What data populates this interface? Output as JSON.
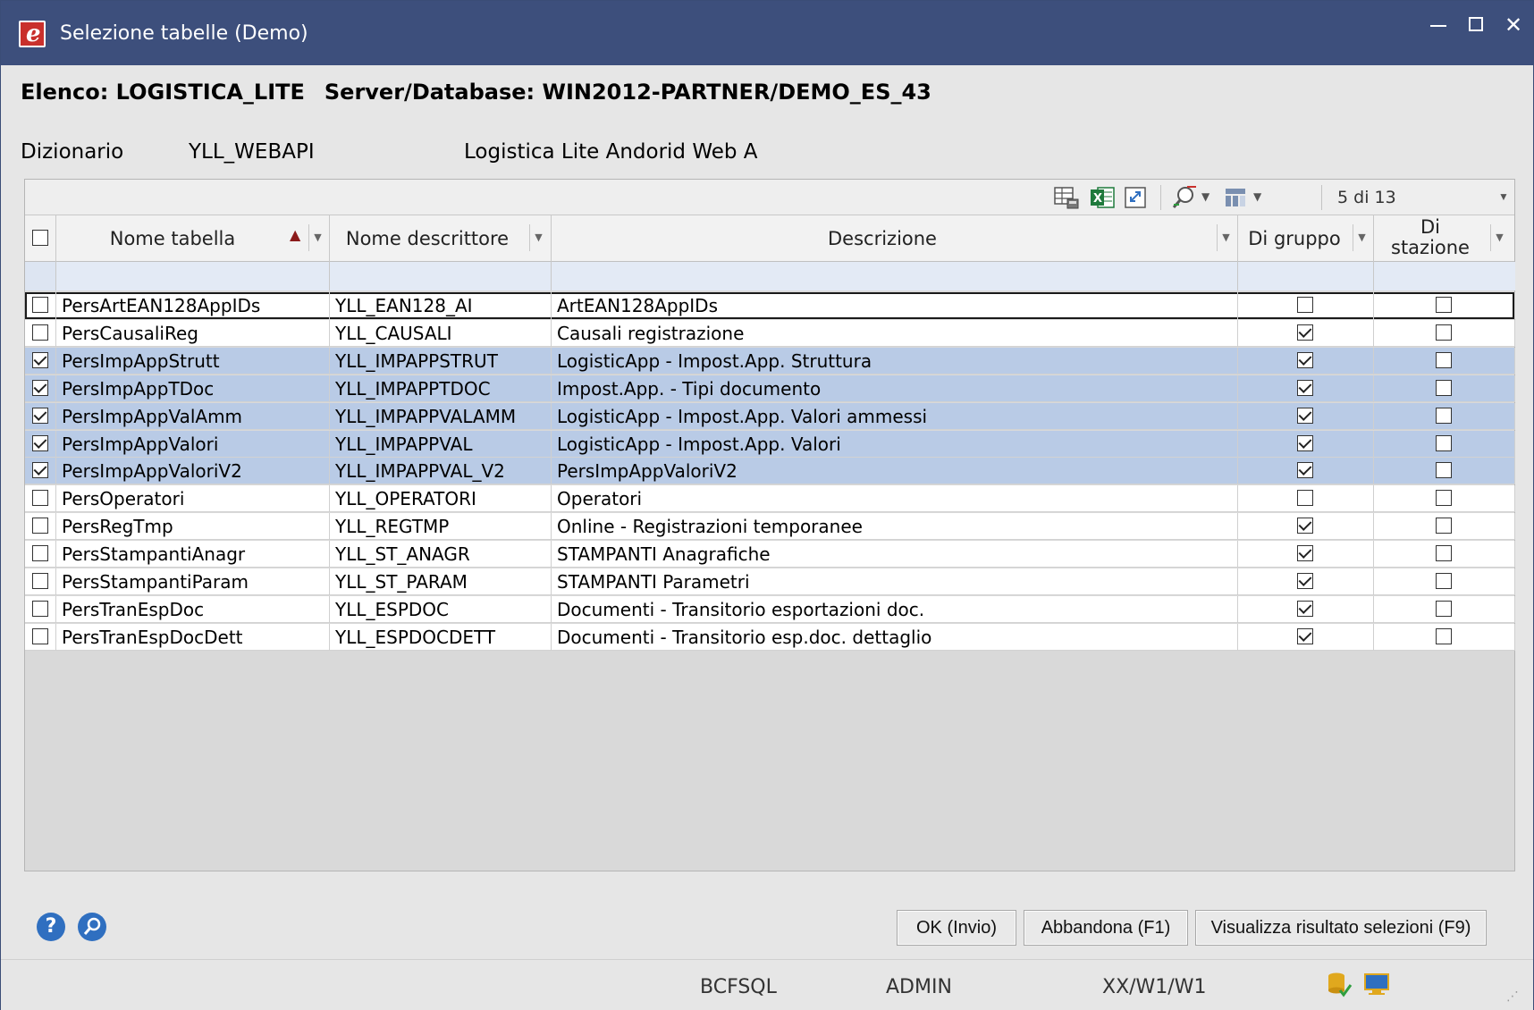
{
  "window": {
    "title": "Selezione tabelle  (Demo)",
    "app_icon_letter": "e",
    "controls": {
      "minimize": "minimize",
      "maximize": "maximize",
      "close": "✕"
    }
  },
  "header": {
    "elenco": "Elenco: LOGISTICA_LITE",
    "server": "Server/Database: WIN2012-PARTNER/DEMO_ES_43"
  },
  "dizionario": {
    "label": "Dizionario",
    "code": "YLL_WEBAPI",
    "description": "Logistica Lite Andorid Web A"
  },
  "toolbar": {
    "icons": [
      "table-export-icon",
      "excel-icon",
      "refresh-icon",
      "search-filter-icon",
      "column-chooser-icon"
    ],
    "pager": "5 di 13"
  },
  "columns": {
    "nome_tabella": "Nome tabella",
    "nome_descrittore": "Nome descrittore",
    "descrizione": "Descrizione",
    "di_gruppo": "Di gruppo",
    "di_stazione_1": "Di",
    "di_stazione_2": "stazione"
  },
  "rows": [
    {
      "selected": false,
      "nome": "PersArtEAN128AppIDs",
      "descrittore": "YLL_EAN128_AI",
      "descrizione": "ArtEAN128AppIDs",
      "gruppo": false,
      "stazione": false
    },
    {
      "selected": false,
      "nome": "PersCausaliReg",
      "descrittore": "YLL_CAUSALI",
      "descrizione": "Causali registrazione",
      "gruppo": true,
      "stazione": false
    },
    {
      "selected": true,
      "nome": "PersImpAppStrutt",
      "descrittore": "YLL_IMPAPPSTRUT",
      "descrizione": "LogisticApp - Impost.App. Struttura",
      "gruppo": true,
      "stazione": false
    },
    {
      "selected": true,
      "nome": "PersImpAppTDoc",
      "descrittore": "YLL_IMPAPPTDOC",
      "descrizione": "Impost.App. - Tipi documento",
      "gruppo": true,
      "stazione": false
    },
    {
      "selected": true,
      "nome": "PersImpAppValAmm",
      "descrittore": "YLL_IMPAPPVALAMM",
      "descrizione": "LogisticApp - Impost.App. Valori ammessi",
      "gruppo": true,
      "stazione": false
    },
    {
      "selected": true,
      "nome": "PersImpAppValori",
      "descrittore": "YLL_IMPAPPVAL",
      "descrizione": "LogisticApp - Impost.App. Valori",
      "gruppo": true,
      "stazione": false
    },
    {
      "selected": true,
      "nome": "PersImpAppValoriV2",
      "descrittore": "YLL_IMPAPPVAL_V2",
      "descrizione": "PersImpAppValoriV2",
      "gruppo": true,
      "stazione": false
    },
    {
      "selected": false,
      "nome": "PersOperatori",
      "descrittore": "YLL_OPERATORI",
      "descrizione": "Operatori",
      "gruppo": false,
      "stazione": false
    },
    {
      "selected": false,
      "nome": "PersRegTmp",
      "descrittore": "YLL_REGTMP",
      "descrizione": "Online - Registrazioni temporanee",
      "gruppo": true,
      "stazione": false
    },
    {
      "selected": false,
      "nome": "PersStampantiAnagr",
      "descrittore": "YLL_ST_ANAGR",
      "descrizione": "STAMPANTI Anagrafiche",
      "gruppo": true,
      "stazione": false
    },
    {
      "selected": false,
      "nome": "PersStampantiParam",
      "descrittore": "YLL_ST_PARAM",
      "descrizione": "STAMPANTI Parametri",
      "gruppo": true,
      "stazione": false
    },
    {
      "selected": false,
      "nome": "PersTranEspDoc",
      "descrittore": "YLL_ESPDOC",
      "descrizione": "Documenti - Transitorio esportazioni doc.",
      "gruppo": true,
      "stazione": false
    },
    {
      "selected": false,
      "nome": "PersTranEspDocDett",
      "descrittore": "YLL_ESPDOCDETT",
      "descrizione": "Documenti - Transitorio esp.doc. dettaglio",
      "gruppo": true,
      "stazione": false
    }
  ],
  "buttons": {
    "ok": "OK (Invio)",
    "abbandona": "Abbandona (F1)",
    "visualizza": "Visualizza risultato selezioni (F9)"
  },
  "status": {
    "db": "BCFSQL",
    "user": "ADMIN",
    "path": "XX/W1/W1"
  },
  "colors": {
    "titlebar": "#3d4f7c",
    "selected_row": "#b9cbe6",
    "sort_arrow": "#8b1a1a"
  }
}
